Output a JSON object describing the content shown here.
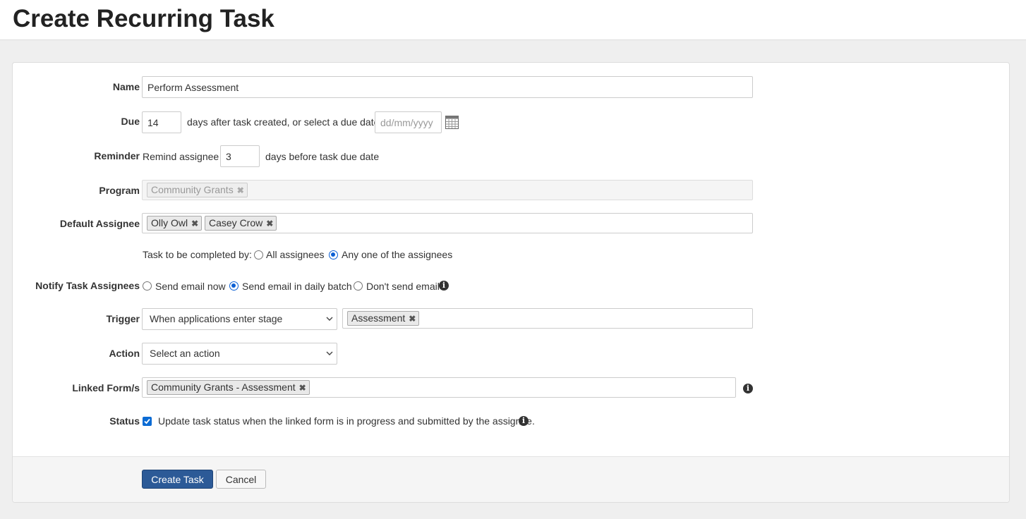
{
  "page": {
    "title": "Create Recurring Task"
  },
  "form": {
    "name": {
      "label": "Name",
      "value": "Perform Assessment"
    },
    "due": {
      "label": "Due",
      "days_value": "14",
      "middle_text": "days after task created, or select a due date",
      "date_placeholder": "dd/mm/yyyy",
      "calendar_icon": "calendar-icon"
    },
    "reminder": {
      "label": "Reminder",
      "prefix": "Remind assignee",
      "days_value": "3",
      "suffix": "days before task due date"
    },
    "program": {
      "label": "Program",
      "tags": [
        {
          "label": "Community Grants"
        }
      ]
    },
    "default_assignee": {
      "label": "Default Assignee",
      "tags": [
        {
          "label": "Olly Owl"
        },
        {
          "label": "Casey Crow"
        }
      ]
    },
    "completed_by": {
      "label": "Task to be completed by:",
      "options": [
        {
          "label": "All assignees",
          "selected": false
        },
        {
          "label": "Any one of the assignees",
          "selected": true
        }
      ]
    },
    "notify": {
      "label": "Notify Task Assignees",
      "options": [
        {
          "label": "Send email now",
          "selected": false
        },
        {
          "label": "Send email in daily batch",
          "selected": true
        },
        {
          "label": "Don't send email",
          "selected": false
        }
      ]
    },
    "trigger": {
      "label": "Trigger",
      "selected": "When applications enter stage",
      "tags": [
        {
          "label": "Assessment"
        }
      ]
    },
    "action": {
      "label": "Action",
      "selected": "Select an action"
    },
    "linked_forms": {
      "label": "Linked Form/s",
      "tags": [
        {
          "label": "Community Grants - Assessment"
        }
      ]
    },
    "status": {
      "label": "Status",
      "checked": true,
      "text": "Update task status when the linked form is in progress and submitted by the assignee."
    }
  },
  "footer": {
    "create_label": "Create Task",
    "cancel_label": "Cancel"
  },
  "colors": {
    "primary": "#2c5a97",
    "radio_accent": "#0b5fd4",
    "page_bg": "#efefef"
  },
  "icons": {
    "remove": "✖",
    "info": "i",
    "chevron": "chevron-down-icon"
  }
}
